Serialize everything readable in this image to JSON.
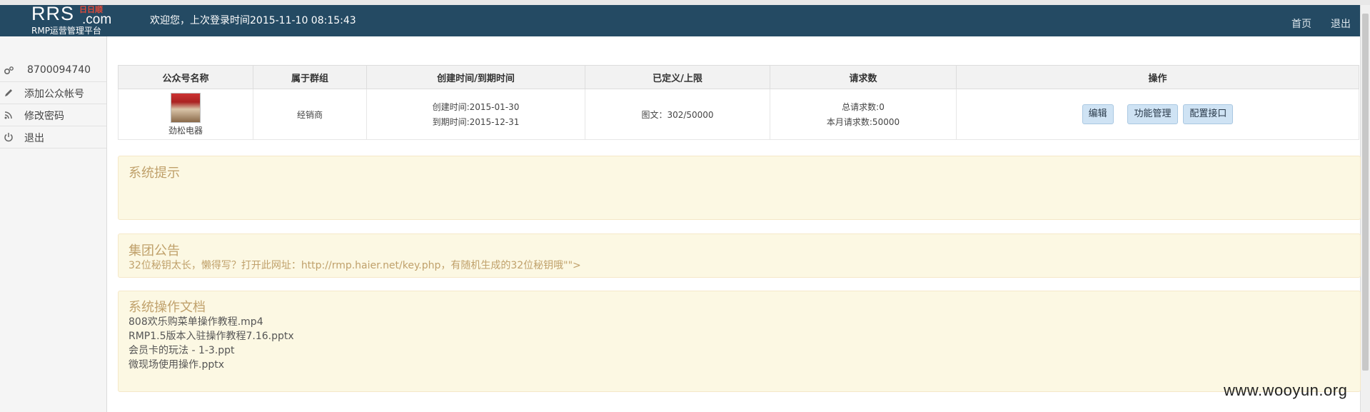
{
  "header": {
    "logo_main": "RRS",
    "logo_com": ".com",
    "logo_cn": "日日顺",
    "logo_sub": "RMP运营管理平台",
    "welcome": "欢迎您，上次登录时间2015-11-10 08:15:43",
    "home_link": "首页",
    "logout_link": "退出",
    "bg_color": "#244a63"
  },
  "sidebar": {
    "items": [
      {
        "icon": "gears-icon",
        "label": "8700094740"
      },
      {
        "icon": "pencil-icon",
        "label": "添加公众帐号"
      },
      {
        "icon": "rss-icon",
        "label": "修改密码"
      },
      {
        "icon": "power-icon",
        "label": "退出"
      }
    ]
  },
  "table": {
    "columns": [
      "公众号名称",
      "属于群组",
      "创建时间/到期时间",
      "已定义/上限",
      "请求数",
      "操作"
    ],
    "rows": [
      {
        "name": "劲松电器",
        "group": "经销商",
        "created": "创建时间:2015-01-30",
        "expires": "到期时间:2015-12-31",
        "defined": "图文：302/50000",
        "total_requests": "总请求数:0",
        "month_requests": "本月请求数:50000",
        "actions": [
          "编辑",
          "功能管理",
          "配置接口"
        ]
      }
    ]
  },
  "panels": {
    "system_tip": {
      "title": "系统提示"
    },
    "group_notice": {
      "title": "集团公告",
      "text": "32位秘钥太长，懒得写？打开此网址：http://rmp.haier.net/key.php，有随机生成的32位秘钥哦\"\">"
    },
    "docs": {
      "title": "系统操作文档",
      "files": [
        "808欢乐购菜单操作教程.mp4",
        "RMP1.5版本入驻操作教程7.16.pptx",
        "会员卡的玩法 - 1-3.ppt",
        "微现场使用操作.pptx"
      ]
    }
  },
  "watermark": "www.wooyun.org"
}
